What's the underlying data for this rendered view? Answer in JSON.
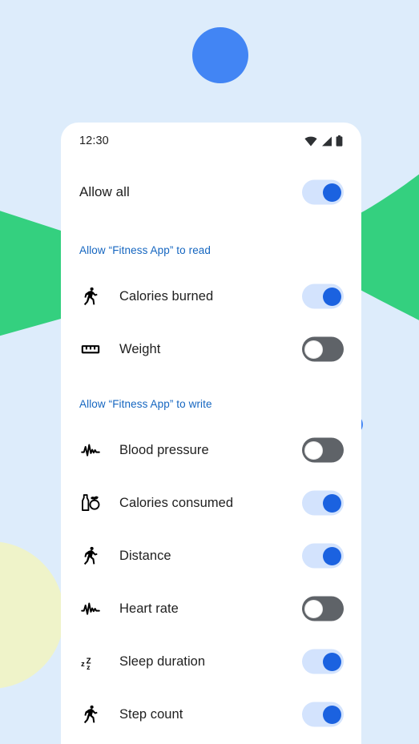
{
  "background": {
    "page_color": "#ddecfb",
    "shapes": [
      {
        "name": "blue-circle-top",
        "color": "#4285f4"
      },
      {
        "name": "green-shape-left",
        "color": "#34d07f"
      },
      {
        "name": "green-shape-right",
        "color": "#34d07f"
      },
      {
        "name": "blue-circle-right",
        "color": "#4285f4"
      },
      {
        "name": "yellow-circle-bottom-left",
        "color": "#eff3c9"
      }
    ]
  },
  "phone": {
    "status_bar": {
      "time": "12:30",
      "icons": [
        "wifi-icon",
        "cellular-signal-icon",
        "battery-icon"
      ]
    },
    "allow_all": {
      "label": "Allow all",
      "toggle_state": "on"
    },
    "sections": [
      {
        "header": "Allow “Fitness App” to read",
        "items": [
          {
            "icon": "running-person-icon",
            "label": "Calories burned",
            "toggle_state": "on"
          },
          {
            "icon": "ruler-scale-icon",
            "label": "Weight",
            "toggle_state": "off"
          }
        ]
      },
      {
        "header": "Allow “Fitness App” to write",
        "items": [
          {
            "icon": "pulse-wave-icon",
            "label": "Blood pressure",
            "toggle_state": "off"
          },
          {
            "icon": "nutrition-icon",
            "label": "Calories consumed",
            "toggle_state": "on"
          },
          {
            "icon": "running-person-icon",
            "label": "Distance",
            "toggle_state": "on"
          },
          {
            "icon": "pulse-wave-icon",
            "label": "Heart rate",
            "toggle_state": "off"
          },
          {
            "icon": "sleep-zzz-icon",
            "label": "Sleep duration",
            "toggle_state": "on"
          },
          {
            "icon": "running-person-icon",
            "label": "Step count",
            "toggle_state": "on"
          }
        ]
      }
    ],
    "colors": {
      "toggle_on_track": "#d3e3fd",
      "toggle_on_thumb": "#1b62e0",
      "toggle_off_track": "#5f6368",
      "toggle_off_thumb": "#ffffff",
      "section_header_text": "#1566c0",
      "label_text": "#1f1f1f",
      "card_background": "#ffffff"
    }
  }
}
